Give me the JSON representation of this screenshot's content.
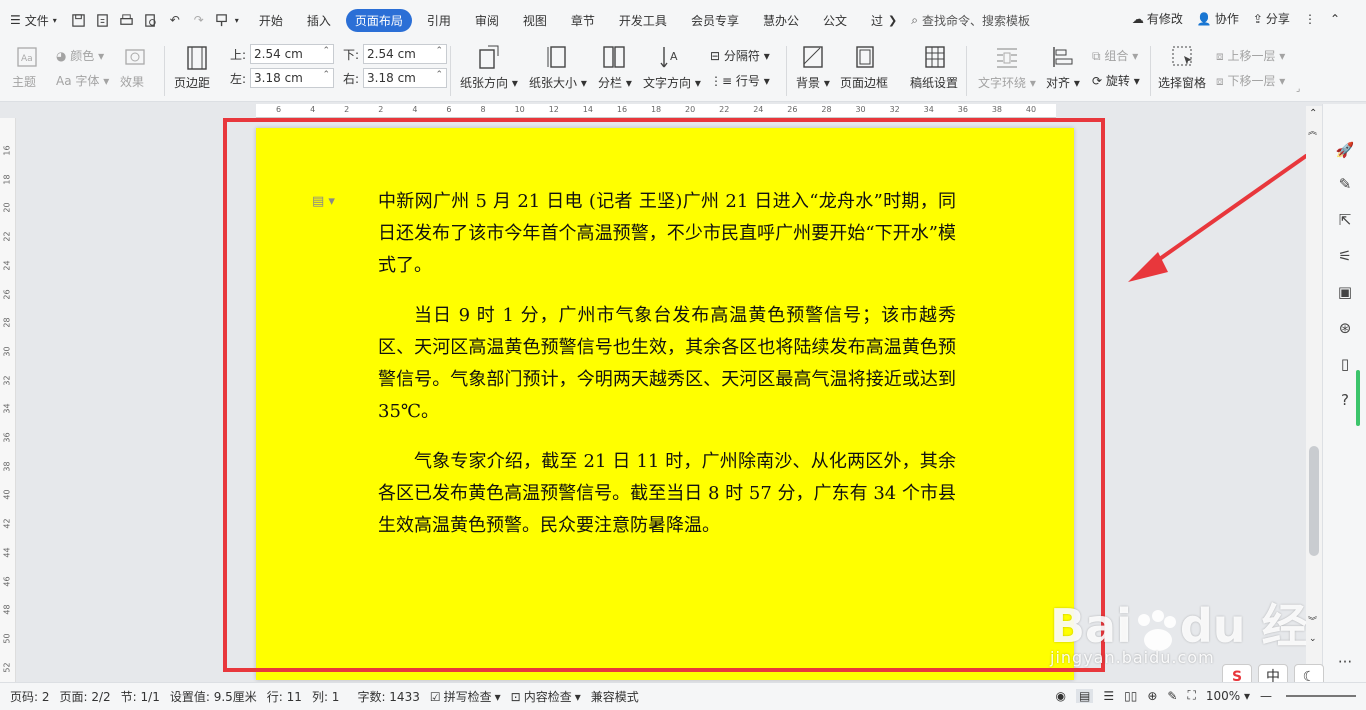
{
  "menubar": {
    "file_label": "文件",
    "tabs": [
      {
        "label": "开始",
        "active": false
      },
      {
        "label": "插入",
        "active": false
      },
      {
        "label": "页面布局",
        "active": true
      },
      {
        "label": "引用",
        "active": false
      },
      {
        "label": "审阅",
        "active": false
      },
      {
        "label": "视图",
        "active": false
      },
      {
        "label": "章节",
        "active": false
      },
      {
        "label": "开发工具",
        "active": false
      },
      {
        "label": "会员专享",
        "active": false
      },
      {
        "label": "慧办公",
        "active": false
      },
      {
        "label": "公文",
        "active": false
      },
      {
        "label": "过",
        "active": false
      }
    ],
    "search_placeholder": "查找命令、搜索模板",
    "has_changes": "有修改",
    "collaborate": "协作",
    "share": "分享"
  },
  "ribbon": {
    "theme": "主题",
    "colors": "颜色",
    "fonts": "Aa 字体",
    "effects": "效果",
    "margins": "页边距",
    "top_label": "上:",
    "top_value": "2.54 cm",
    "bottom_label": "下:",
    "bottom_value": "2.54 cm",
    "left_label": "左:",
    "left_value": "3.18 cm",
    "right_label": "右:",
    "right_value": "3.18 cm",
    "orientation": "纸张方向",
    "size": "纸张大小",
    "columns": "分栏",
    "text_direction": "文字方向",
    "breaks": "分隔符",
    "line_numbers": "行号",
    "background": "背景",
    "page_border": "页面边框",
    "manuscript": "稿纸设置",
    "text_wrap": "文字环绕",
    "align": "对齐",
    "group": "组合",
    "rotate": "旋转",
    "selection_pane": "选择窗格",
    "bring_forward": "上移一层",
    "send_backward": "下移一层"
  },
  "ruler": {
    "h_ticks": [
      "6",
      "4",
      "2",
      "2",
      "4",
      "6",
      "8",
      "10",
      "12",
      "14",
      "16",
      "18",
      "20",
      "22",
      "24",
      "26",
      "28",
      "30",
      "32",
      "34",
      "36",
      "38",
      "40"
    ],
    "v_ticks": [
      "16",
      "18",
      "20",
      "22",
      "24",
      "26",
      "28",
      "30",
      "32",
      "34",
      "36",
      "38",
      "40",
      "42",
      "44",
      "46",
      "48",
      "50",
      "52"
    ]
  },
  "document": {
    "paragraphs": [
      {
        "text": "中新网广州 5 月 21 日电 (记者 王坚)广州 21 日进入“龙舟水”时期，同日还发布了该市今年首个高温预警，不少市民直呼广州要开始“下开水”模式了。",
        "indent": false
      },
      {
        "text": "当日 9 时 1 分，广州市气象台发布高温黄色预警信号；该市越秀区、天河区高温黄色预警信号也生效，其余各区也将陆续发布高温黄色预警信号。气象部门预计，今明两天越秀区、天河区最高气温将接近或达到 35℃。",
        "indent": true
      },
      {
        "text": "气象专家介绍，截至 21 日 11 时，广州除南沙、从化两区外，其余各区已发布黄色高温预警信号。截至当日 8 时 57 分，广东有 34 个市县生效高温黄色预警。民众要注意防暑降温。",
        "indent": true
      }
    ],
    "page_color": "#ffff00"
  },
  "status": {
    "page_no": "页码: 2",
    "pages": "页面: 2/2",
    "section": "节: 1/1",
    "setting": "设置值: 9.5厘米",
    "line": "行: 11",
    "column": "列: 1",
    "word_count": "字数: 1433",
    "spell_check": "拼写检查",
    "content_check": "内容检查",
    "compat_mode": "兼容模式",
    "zoom": "100%"
  },
  "ime": {
    "cn": "中",
    "s": "S"
  },
  "watermark": {
    "main": "Bai du 经验",
    "sub": "jingyan.baidu.com"
  },
  "colors": {
    "accent": "#2b6fd6",
    "annotation_red": "#e8373c",
    "highlight": "#ffff00"
  }
}
